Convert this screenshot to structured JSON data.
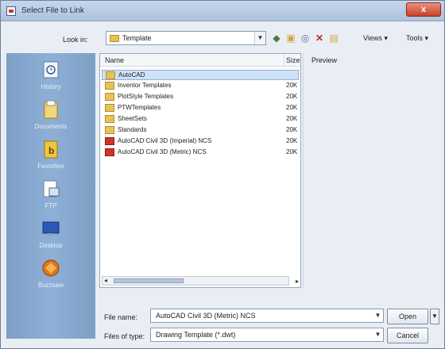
{
  "window": {
    "title": "Select File to Link",
    "close_label": "x"
  },
  "toolbar": {
    "look_in_label": "Look in:",
    "look_in_value": "Template",
    "dropdown_icon": "chevron-down-icon",
    "views_label": "Views",
    "tools_label": "Tools"
  },
  "places": [
    {
      "label": "History",
      "icon": "history-icon"
    },
    {
      "label": "Documents",
      "icon": "documents-icon"
    },
    {
      "label": "Favorites",
      "icon": "favorites-icon"
    },
    {
      "label": "FTP",
      "icon": "ftp-icon"
    },
    {
      "label": "Desktop",
      "icon": "desktop-icon"
    },
    {
      "label": "Buzzsaw",
      "icon": "buzzsaw-icon"
    }
  ],
  "file_list": {
    "columns": [
      "Name",
      "Size"
    ],
    "rows": [
      {
        "name": "AutoCAD",
        "size": "",
        "type": "folder",
        "selected": true
      },
      {
        "name": "Inventor Templates",
        "size": "20K",
        "type": "folder"
      },
      {
        "name": "PlotStyle Templates",
        "size": "20K",
        "type": "folder"
      },
      {
        "name": "PTWTemplates",
        "size": "20K",
        "type": "folder"
      },
      {
        "name": "SheetSets",
        "size": "20K",
        "type": "folder"
      },
      {
        "name": "Standards",
        "size": "20K",
        "type": "folder"
      },
      {
        "name": "AutoCAD Civil 3D (Imperial) NCS",
        "size": "20K",
        "type": "file"
      },
      {
        "name": "AutoCAD Civil 3D (Metric) NCS",
        "size": "20K",
        "type": "file"
      }
    ]
  },
  "preview": {
    "label": "Preview"
  },
  "bottom": {
    "file_name_label": "File name:",
    "file_name_value": "AutoCAD Civil 3D (Metric) NCS",
    "file_type_label": "Files of type:",
    "file_type_value": "Drawing Template (*.dwt)",
    "open_label": "Open",
    "cancel_label": "Cancel"
  }
}
